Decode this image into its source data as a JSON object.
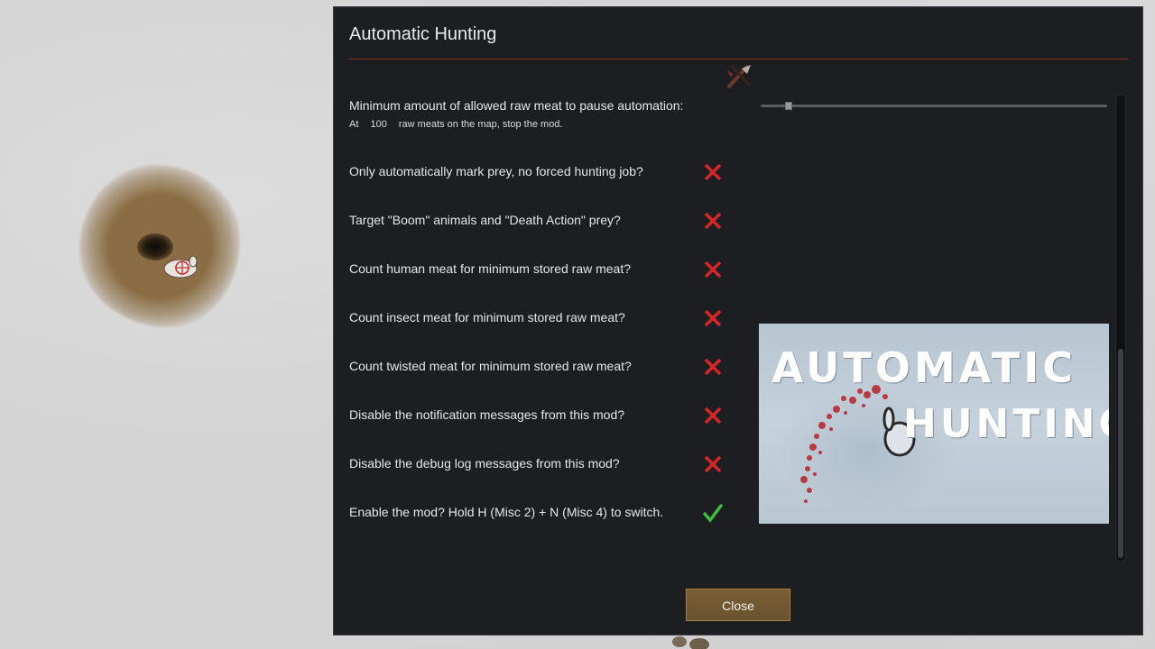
{
  "dialog": {
    "title": "Automatic Hunting",
    "close_icon": "close-x-icon",
    "header_icon": "hunting-knife-icon",
    "close_button_label": "Close"
  },
  "slider": {
    "label": "Minimum amount of allowed raw meat to pause automation:",
    "sub_prefix": "At",
    "value": "100",
    "sub_suffix": "raw meats on the map, stop the mod.",
    "fraction": 0.08
  },
  "options": [
    {
      "label": "Only automatically mark prey, no forced hunting job?",
      "checked": false
    },
    {
      "label": "Target \"Boom\" animals and \"Death Action\" prey?",
      "checked": false
    },
    {
      "label": "Count human meat for minimum stored raw meat?",
      "checked": false
    },
    {
      "label": "Count insect meat for minimum stored raw meat?",
      "checked": false
    },
    {
      "label": "Count twisted meat for minimum stored raw meat?",
      "checked": false
    },
    {
      "label": "Disable the notification messages from this mod?",
      "checked": false
    },
    {
      "label": "Disable the debug log messages from this mod?",
      "checked": false
    },
    {
      "label": "Enable the mod? Hold H (Misc 2)    +    N (Misc 4) to switch.",
      "checked": true
    }
  ],
  "preview": {
    "logo_line1": "AUTOMATIC",
    "logo_line2": "HUNTING"
  },
  "colors": {
    "cross": "#d32626",
    "check": "#3ec23e",
    "title_rule": "#8a2a26",
    "button": "#6e5531"
  }
}
